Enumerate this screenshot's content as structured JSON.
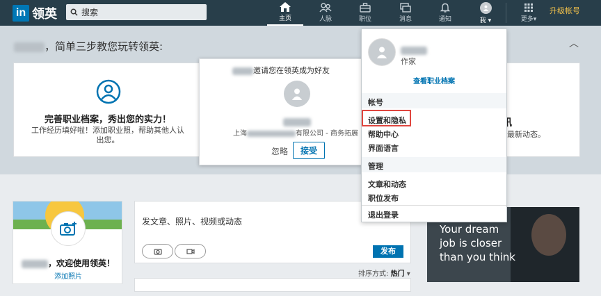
{
  "topbar": {
    "logo_text": "in",
    "brand": "领英",
    "search_placeholder": "搜索",
    "nav": [
      {
        "label": "主页",
        "icon": "home-icon"
      },
      {
        "label": "人脉",
        "icon": "people-icon"
      },
      {
        "label": "职位",
        "icon": "briefcase-icon"
      },
      {
        "label": "消息",
        "icon": "message-icon"
      },
      {
        "label": "通知",
        "icon": "bell-icon"
      },
      {
        "label": "我",
        "icon": "avatar-icon"
      },
      {
        "label": "更多",
        "icon": "grid-icon"
      }
    ],
    "upgrade": "升级帐号"
  },
  "onboarding": {
    "title_suffix": "，简单三步教您玩转领英:",
    "card1": {
      "title": "完善职业档案，秀出您的实力！",
      "desc": "工作经历填好啦！添加职业照，帮助其他人认出您。"
    },
    "card2": {
      "invite": "邀请您在领英成为好友",
      "company_prefix": "上海",
      "company_suffix": "有限公司 - 商务拓展",
      "ignore": "忽略",
      "accept": "接受"
    },
    "card3": {
      "title_fragment": "讯",
      "desc_fragment": "最新动态。"
    }
  },
  "dropdown": {
    "role": "作家",
    "view_profile": "查看职业档案",
    "account_header": "帐号",
    "account_items": [
      "设置和隐私",
      "帮助中心",
      "界面语言"
    ],
    "manage_header": "管理",
    "manage_items": [
      "文章和动态",
      "职位发布"
    ],
    "logout": "退出登录"
  },
  "profile_card": {
    "welcome_suffix": "，欢迎使用领英！",
    "add_photo": "添加照片"
  },
  "share": {
    "placeholder": "发文章、照片、视频或动态",
    "post": "发布",
    "sort_label": "排序方式:",
    "sort_value": "热门"
  },
  "ad": {
    "text": "Your dream job is closer than you think"
  },
  "colors": {
    "topbar": "#283e4a",
    "accent": "#0073b1",
    "upgrade": "#f5c34b",
    "highlight": "#e0463f"
  }
}
